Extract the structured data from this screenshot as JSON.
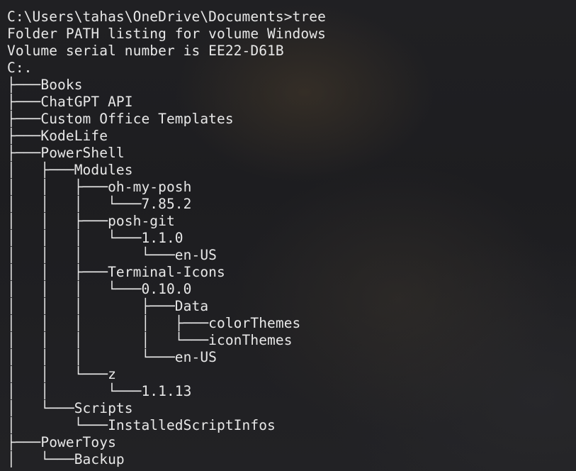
{
  "terminal": {
    "prompt_line": "C:\\Users\\tahas\\OneDrive\\Documents>tree",
    "header_line_1": "Folder PATH listing for volume Windows",
    "header_line_2": "Volume serial number is EE22-D61B",
    "root": "C:.",
    "tree_lines": [
      "├───Books",
      "├───ChatGPT API",
      "├───Custom Office Templates",
      "├───KodeLife",
      "├───PowerShell",
      "│   ├───Modules",
      "│   │   ├───oh-my-posh",
      "│   │   │   └───7.85.2",
      "│   │   ├───posh-git",
      "│   │   │   └───1.1.0",
      "│   │   │       └───en-US",
      "│   │   ├───Terminal-Icons",
      "│   │   │   └───0.10.0",
      "│   │   │       ├───Data",
      "│   │   │       │   ├───colorThemes",
      "│   │   │       │   └───iconThemes",
      "│   │   │       └───en-US",
      "│   │   └───z",
      "│   │       └───1.1.13",
      "│   └───Scripts",
      "│       └───InstalledScriptInfos",
      "├───PowerToys",
      "│   └───Backup"
    ]
  }
}
